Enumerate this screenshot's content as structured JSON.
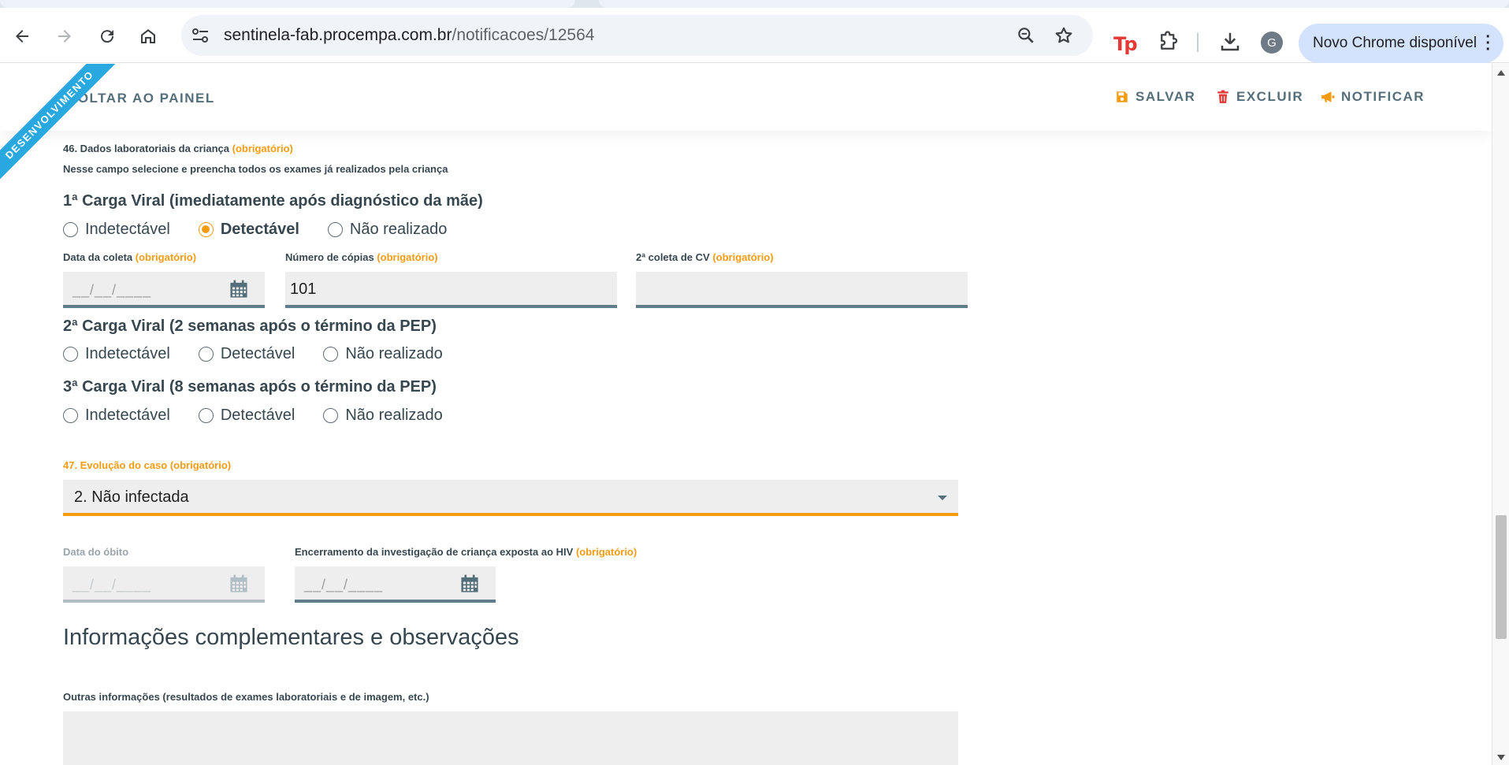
{
  "browser": {
    "url_host": "sentinela-fab.procempa.com.br",
    "url_path": "/notificacoes/12564",
    "profile_initial": "G",
    "update_label": "Novo Chrome disponível",
    "extension_label": "Tp"
  },
  "header": {
    "back_label": "VOLTAR AO PAINEL",
    "save_label": "SALVAR",
    "delete_label": "EXCLUIR",
    "notify_label": "NOTIFICAR",
    "env_ribbon": "DESENVOLVIMENTO"
  },
  "colors": {
    "accent": "#f39c12",
    "ribbon": "#29a8df",
    "text": "#37474f",
    "field_underline": "#607d8b"
  },
  "q46": {
    "label": "46. Dados laboratoriais da criança",
    "required": "(obrigatório)",
    "help": "Nesse campo selecione e preencha todos os exames já realizados pela criança"
  },
  "cv1": {
    "title": "1ª Carga Viral (imediatamente após diagnóstico da mãe)",
    "options": [
      "Indetectável",
      "Detectável",
      "Não realizado"
    ],
    "selected": "Detectável",
    "date_label": "Data da coleta",
    "date_required": "(obrigatório)",
    "date_placeholder": "__/__/____",
    "copies_label": "Número de cópias",
    "copies_required": "(obrigatório)",
    "copies_value": "101",
    "second_label": "2ª coleta de CV",
    "second_required": "(obrigatório)"
  },
  "cv2": {
    "title": "2ª Carga Viral (2 semanas após o término da PEP)",
    "options": [
      "Indetectável",
      "Detectável",
      "Não realizado"
    ]
  },
  "cv3": {
    "title": "3ª Carga Viral (8 semanas após o término da PEP)",
    "options": [
      "Indetectável",
      "Detectável",
      "Não realizado"
    ]
  },
  "q47": {
    "label": "47. Evolução do caso (obrigatório)",
    "selected": "2. Não infectada"
  },
  "death": {
    "label": "Data do óbito",
    "placeholder": "__/__/____"
  },
  "closure": {
    "label": "Encerramento da investigação de criança exposta ao HIV",
    "required": "(obrigatório)",
    "placeholder": "__/__/____"
  },
  "complementary": {
    "title": "Informações complementares e observações",
    "other_label": "Outras informações (resultados de exames laboratoriais e de imagem, etc.)"
  }
}
